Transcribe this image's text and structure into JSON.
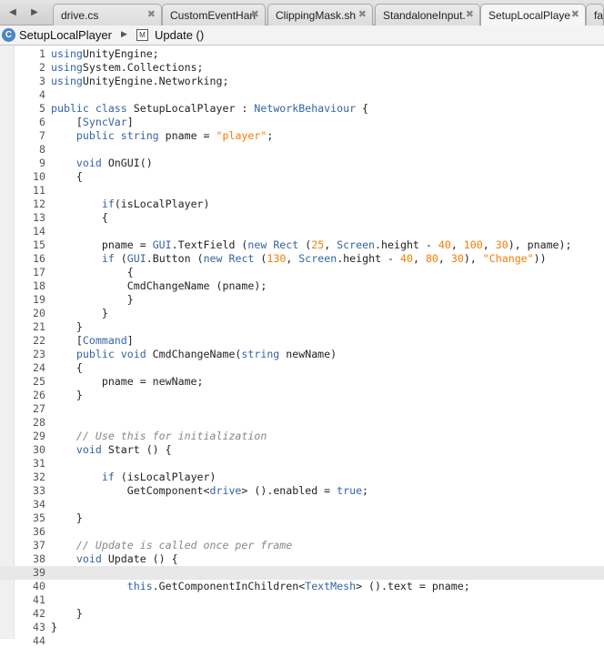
{
  "tabs": [
    {
      "label": "drive.cs",
      "active": false
    },
    {
      "label": "CustomEventHan",
      "active": false
    },
    {
      "label": "ClippingMask.sh",
      "active": false
    },
    {
      "label": "StandaloneInput.",
      "active": false
    },
    {
      "label": "SetupLocalPlaye",
      "active": true
    },
    {
      "label": "fac",
      "active": false
    }
  ],
  "path": {
    "class_name": "SetupLocalPlayer",
    "method_name": "Update ()"
  },
  "current_line": 39,
  "code_lines": [
    [
      [
        "kw",
        "using"
      ],
      [
        "",
        "UnityEngine;"
      ]
    ],
    [
      [
        "kw",
        "using"
      ],
      [
        "",
        "System.Collections;"
      ]
    ],
    [
      [
        "kw",
        "using"
      ],
      [
        "",
        "UnityEngine.Networking;"
      ]
    ],
    [],
    [
      [
        "kw",
        "public class"
      ],
      [
        "",
        " SetupLocalPlayer : "
      ],
      [
        "kw",
        "NetworkBehaviour"
      ],
      [
        "",
        " {"
      ]
    ],
    [
      [
        "",
        "    ["
      ],
      [
        "at",
        "SyncVar"
      ],
      [
        "",
        "]"
      ]
    ],
    [
      [
        "kw",
        "    public string"
      ],
      [
        "",
        " pname = "
      ],
      [
        "str",
        "\"player\""
      ],
      [
        "",
        ";"
      ]
    ],
    [],
    [
      [
        "kw",
        "    void"
      ],
      [
        "",
        " OnGUI()"
      ]
    ],
    [
      [
        "",
        "    {"
      ]
    ],
    [],
    [
      [
        "kw",
        "        if"
      ],
      [
        "",
        "(isLocalPlayer)"
      ]
    ],
    [
      [
        "",
        "        {"
      ]
    ],
    [],
    [
      [
        "",
        "        pname = "
      ],
      [
        "kw",
        "GUI"
      ],
      [
        "",
        ".TextField ("
      ],
      [
        "kw",
        "new Rect"
      ],
      [
        "",
        " ("
      ],
      [
        "num",
        "25"
      ],
      [
        "",
        ", "
      ],
      [
        "kw",
        "Screen"
      ],
      [
        "",
        ".height - "
      ],
      [
        "num",
        "40"
      ],
      [
        "",
        ", "
      ],
      [
        "num",
        "100"
      ],
      [
        "",
        ", "
      ],
      [
        "num",
        "30"
      ],
      [
        "",
        "), pname);"
      ]
    ],
    [
      [
        "kw",
        "        if"
      ],
      [
        "",
        " ("
      ],
      [
        "kw",
        "GUI"
      ],
      [
        "",
        ".Button ("
      ],
      [
        "kw",
        "new Rect"
      ],
      [
        "",
        " ("
      ],
      [
        "num",
        "130"
      ],
      [
        "",
        ", "
      ],
      [
        "kw",
        "Screen"
      ],
      [
        "",
        ".height - "
      ],
      [
        "num",
        "40"
      ],
      [
        "",
        ", "
      ],
      [
        "num",
        "80"
      ],
      [
        "",
        ", "
      ],
      [
        "num",
        "30"
      ],
      [
        "",
        "), "
      ],
      [
        "str",
        "\"Change\""
      ],
      [
        "",
        "))"
      ]
    ],
    [
      [
        "",
        "            {"
      ]
    ],
    [
      [
        "",
        "            CmdChangeName (pname);"
      ]
    ],
    [
      [
        "",
        "            }"
      ]
    ],
    [
      [
        "",
        "        }"
      ]
    ],
    [
      [
        "",
        "    }"
      ]
    ],
    [
      [
        "",
        "    ["
      ],
      [
        "at",
        "Command"
      ],
      [
        "",
        "]"
      ]
    ],
    [
      [
        "kw",
        "    public void"
      ],
      [
        "",
        " CmdChangeName("
      ],
      [
        "kw",
        "string"
      ],
      [
        "",
        " newName)"
      ]
    ],
    [
      [
        "",
        "    {"
      ]
    ],
    [
      [
        "",
        "        pname = newName;"
      ]
    ],
    [
      [
        "",
        "    }"
      ]
    ],
    [],
    [],
    [
      [
        "cm",
        "    // Use this for initialization"
      ]
    ],
    [
      [
        "kw",
        "    void"
      ],
      [
        "",
        " Start () {"
      ]
    ],
    [],
    [
      [
        "kw",
        "        if"
      ],
      [
        "",
        " (isLocalPlayer)"
      ]
    ],
    [
      [
        "",
        "            GetComponent<"
      ],
      [
        "kw",
        "drive"
      ],
      [
        "",
        "> ().enabled = "
      ],
      [
        "kw",
        "true"
      ],
      [
        "",
        ";"
      ]
    ],
    [],
    [
      [
        "",
        "    }"
      ]
    ],
    [],
    [
      [
        "cm",
        "    // Update is called once per frame"
      ]
    ],
    [
      [
        "kw",
        "    void"
      ],
      [
        "",
        " Update () {"
      ]
    ],
    [],
    [
      [
        "kw",
        "            this"
      ],
      [
        "",
        ".GetComponentInChildren<"
      ],
      [
        "kw",
        "TextMesh"
      ],
      [
        "",
        "> ().text = pname;"
      ]
    ],
    [],
    [
      [
        "",
        "    }"
      ]
    ],
    [
      [
        "",
        "}"
      ]
    ],
    [
      [
        "",
        ""
      ]
    ]
  ]
}
